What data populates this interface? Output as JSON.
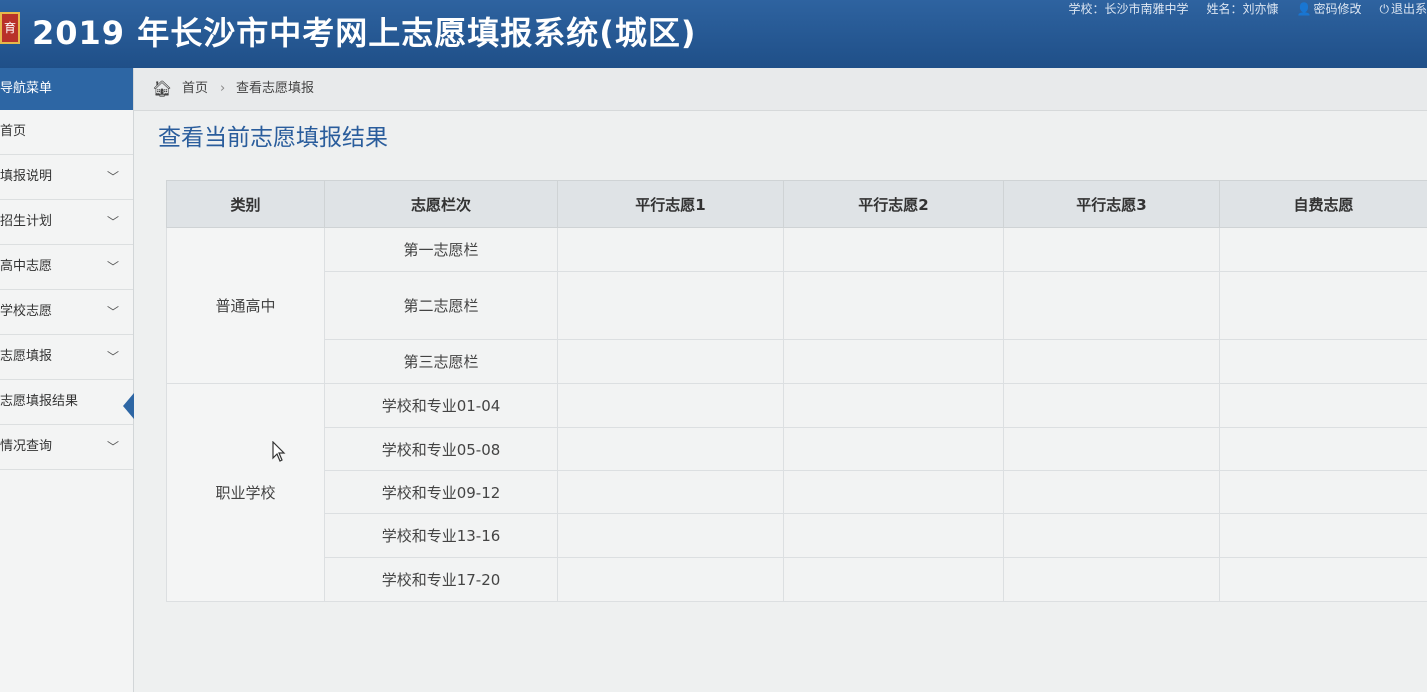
{
  "header": {
    "logo_text": "育",
    "title": "2019 年长沙市中考网上志愿填报系统(城区)",
    "school": "学校：长沙市南雅中学",
    "name": "姓名：刘亦慷",
    "change_password": "密码修改",
    "logout": "退出系"
  },
  "sidebar": {
    "heading": "导航菜单",
    "items": [
      {
        "label": "首页",
        "expandable": false
      },
      {
        "label": "填报说明",
        "expandable": true
      },
      {
        "label": "招生计划",
        "expandable": true
      },
      {
        "label": "高中志愿",
        "expandable": true
      },
      {
        "label": "学校志愿",
        "expandable": true
      },
      {
        "label": "志愿填报",
        "expandable": true
      },
      {
        "label": "志愿填报结果",
        "expandable": false,
        "active": true
      },
      {
        "label": "情况查询",
        "expandable": true
      }
    ]
  },
  "breadcrumb": {
    "home": "首页",
    "separator": "›",
    "current": "查看志愿填报"
  },
  "page_title": "查看当前志愿填报结果",
  "table": {
    "headers": [
      "类别",
      "志愿栏次",
      "平行志愿1",
      "平行志愿2",
      "平行志愿3",
      "自费志愿"
    ],
    "groups": [
      {
        "category": "普通高中",
        "rows": [
          "第一志愿栏",
          "第二志愿栏",
          "第三志愿栏"
        ]
      },
      {
        "category": "职业学校",
        "rows": [
          "学校和专业01-04",
          "学校和专业05-08",
          "学校和专业09-12",
          "学校和专业13-16",
          "学校和专业17-20"
        ]
      }
    ]
  },
  "icons": {
    "home": "home-icon",
    "chevron": "chevron-down-icon",
    "user": "user-icon",
    "power": "power-icon"
  },
  "colors": {
    "header_bg": "#1f4f88",
    "accent": "#2d66a4",
    "title": "#2a5d9c"
  }
}
